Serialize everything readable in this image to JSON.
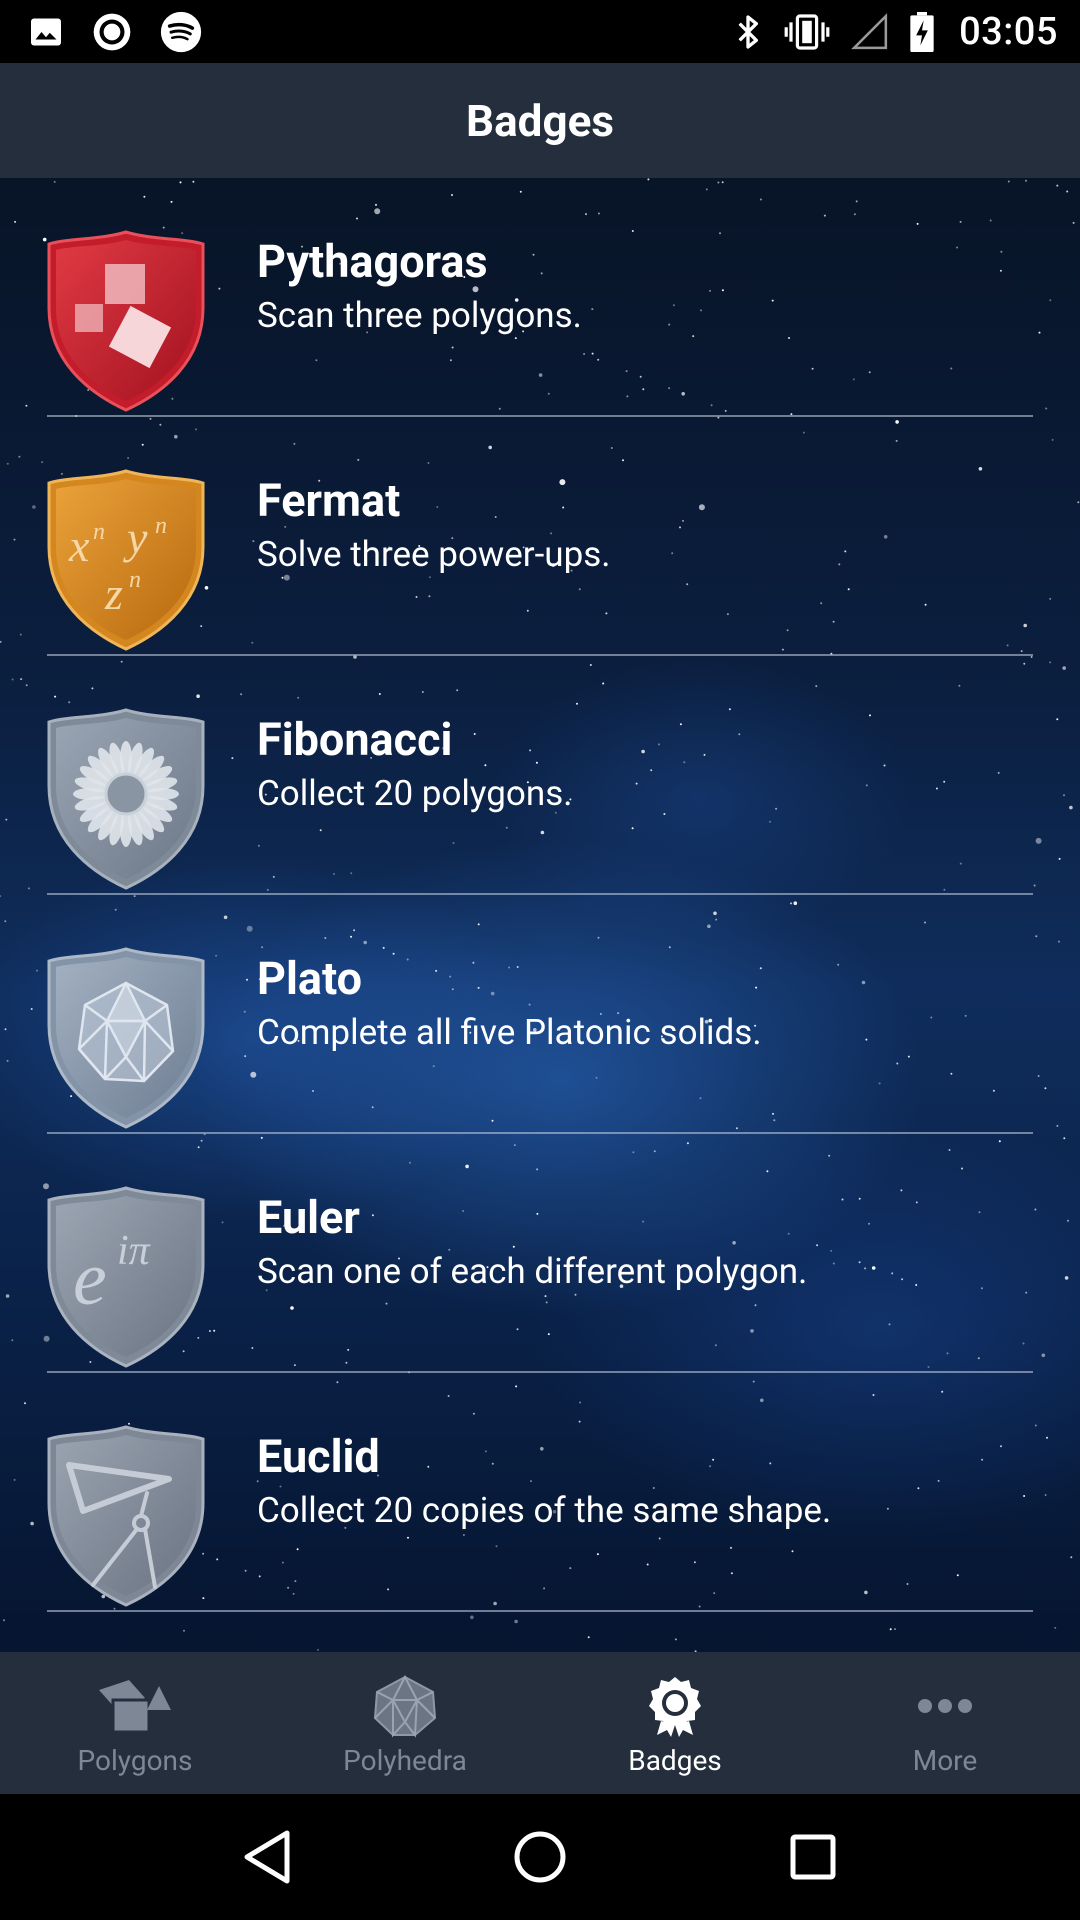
{
  "status_bar": {
    "time": "03:05",
    "left_icons": [
      "image-icon",
      "record-icon",
      "spotify-icon"
    ],
    "right_icons": [
      "bluetooth-icon",
      "vibrate-icon",
      "signal-icon",
      "battery-charging-icon"
    ]
  },
  "app_bar": {
    "title": "Badges"
  },
  "badges": [
    {
      "name": "Pythagoras",
      "description": "Scan three polygons.",
      "icon": "pythagoras-shield-icon",
      "color": "#c8202f",
      "unlocked": true
    },
    {
      "name": "Fermat",
      "description": "Solve three power-ups.",
      "icon": "fermat-shield-icon",
      "color": "#d98a1f",
      "unlocked": true
    },
    {
      "name": "Fibonacci",
      "description": "Collect 20 polygons.",
      "icon": "fibonacci-shield-icon",
      "color": "#7d8898",
      "unlocked": false
    },
    {
      "name": "Plato",
      "description": "Complete all five Platonic solids.",
      "icon": "plato-shield-icon",
      "color": "#8494a8",
      "unlocked": false
    },
    {
      "name": "Euler",
      "description": "Scan one of each different polygon.",
      "icon": "euler-shield-icon",
      "color": "#7f8a99",
      "unlocked": false
    },
    {
      "name": "Euclid",
      "description": "Collect 20 copies of the same shape.",
      "icon": "euclid-shield-icon",
      "color": "#7d8795",
      "unlocked": false
    }
  ],
  "bottom_nav": {
    "items": [
      {
        "label": "Polygons",
        "icon": "polygons-icon",
        "active": false
      },
      {
        "label": "Polyhedra",
        "icon": "polyhedra-icon",
        "active": false
      },
      {
        "label": "Badges",
        "icon": "badge-icon",
        "active": true
      },
      {
        "label": "More",
        "icon": "more-dots-icon",
        "active": false
      }
    ]
  },
  "system_nav": {
    "buttons": [
      "back-icon",
      "home-icon",
      "recents-icon"
    ]
  },
  "colors": {
    "bar_bg": "#242e3d",
    "inactive_nav": "#7d8796",
    "active_nav": "#ffffff"
  }
}
